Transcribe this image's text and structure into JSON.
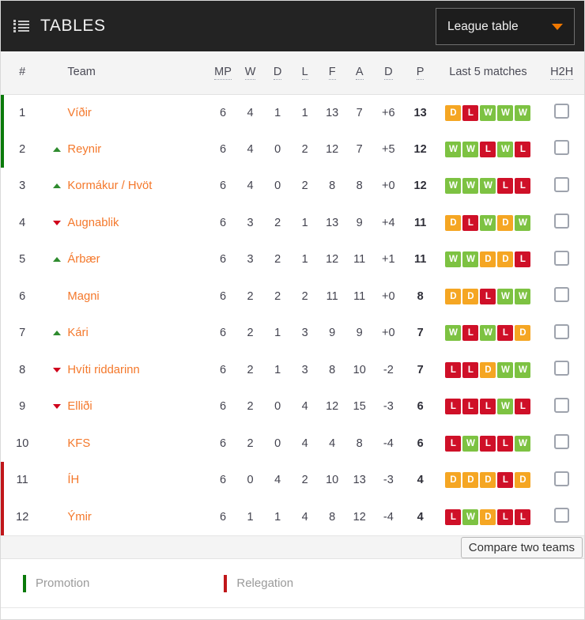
{
  "header": {
    "menu_icon": "list-icon",
    "title": "TABLES",
    "dropdown_label": "League table",
    "dropdown_icon": "chevron-down-icon",
    "accent_color": "#f07800",
    "background": "#232323"
  },
  "table": {
    "columns": {
      "rank": "#",
      "team": "Team",
      "mp": "MP",
      "w": "W",
      "d": "D",
      "l": "L",
      "f": "F",
      "a": "A",
      "gd": "D",
      "p": "P",
      "form": "Last 5 matches",
      "h2h": "H2H"
    },
    "rows": [
      {
        "rank": "1",
        "movement": "none",
        "team": "Víðir",
        "mp": "6",
        "w": "4",
        "d": "1",
        "l": "1",
        "f": "13",
        "a": "7",
        "gd": "+6",
        "p": "13",
        "form": [
          "D",
          "L",
          "W",
          "W",
          "W"
        ],
        "zone": "promotion"
      },
      {
        "rank": "2",
        "movement": "up",
        "team": "Reynir",
        "mp": "6",
        "w": "4",
        "d": "0",
        "l": "2",
        "f": "12",
        "a": "7",
        "gd": "+5",
        "p": "12",
        "form": [
          "W",
          "W",
          "L",
          "W",
          "L"
        ],
        "zone": "promotion"
      },
      {
        "rank": "3",
        "movement": "up",
        "team": "Kormákur / Hvöt",
        "mp": "6",
        "w": "4",
        "d": "0",
        "l": "2",
        "f": "8",
        "a": "8",
        "gd": "+0",
        "p": "12",
        "form": [
          "W",
          "W",
          "W",
          "L",
          "L"
        ],
        "zone": "none"
      },
      {
        "rank": "4",
        "movement": "down",
        "team": "Augnablik",
        "mp": "6",
        "w": "3",
        "d": "2",
        "l": "1",
        "f": "13",
        "a": "9",
        "gd": "+4",
        "p": "11",
        "form": [
          "D",
          "L",
          "W",
          "D",
          "W"
        ],
        "zone": "none"
      },
      {
        "rank": "5",
        "movement": "up",
        "team": "Árbær",
        "mp": "6",
        "w": "3",
        "d": "2",
        "l": "1",
        "f": "12",
        "a": "11",
        "gd": "+1",
        "p": "11",
        "form": [
          "W",
          "W",
          "D",
          "D",
          "L"
        ],
        "zone": "none"
      },
      {
        "rank": "6",
        "movement": "none",
        "team": "Magni",
        "mp": "6",
        "w": "2",
        "d": "2",
        "l": "2",
        "f": "11",
        "a": "11",
        "gd": "+0",
        "p": "8",
        "form": [
          "D",
          "D",
          "L",
          "W",
          "W"
        ],
        "zone": "none"
      },
      {
        "rank": "7",
        "movement": "up",
        "team": "Kári",
        "mp": "6",
        "w": "2",
        "d": "1",
        "l": "3",
        "f": "9",
        "a": "9",
        "gd": "+0",
        "p": "7",
        "form": [
          "W",
          "L",
          "W",
          "L",
          "D"
        ],
        "zone": "none"
      },
      {
        "rank": "8",
        "movement": "down",
        "team": "Hvíti riddarinn",
        "mp": "6",
        "w": "2",
        "d": "1",
        "l": "3",
        "f": "8",
        "a": "10",
        "gd": "-2",
        "p": "7",
        "form": [
          "L",
          "L",
          "D",
          "W",
          "W"
        ],
        "zone": "none"
      },
      {
        "rank": "9",
        "movement": "down",
        "team": "Elliði",
        "mp": "6",
        "w": "2",
        "d": "0",
        "l": "4",
        "f": "12",
        "a": "15",
        "gd": "-3",
        "p": "6",
        "form": [
          "L",
          "L",
          "L",
          "W",
          "L"
        ],
        "zone": "none"
      },
      {
        "rank": "10",
        "movement": "none",
        "team": "KFS",
        "mp": "6",
        "w": "2",
        "d": "0",
        "l": "4",
        "f": "4",
        "a": "8",
        "gd": "-4",
        "p": "6",
        "form": [
          "L",
          "W",
          "L",
          "L",
          "W"
        ],
        "zone": "none"
      },
      {
        "rank": "11",
        "movement": "none",
        "team": "ÍH",
        "mp": "6",
        "w": "0",
        "d": "4",
        "l": "2",
        "f": "10",
        "a": "13",
        "gd": "-3",
        "p": "4",
        "form": [
          "D",
          "D",
          "D",
          "L",
          "D"
        ],
        "zone": "relegation"
      },
      {
        "rank": "12",
        "movement": "none",
        "team": "Ýmir",
        "mp": "6",
        "w": "1",
        "d": "1",
        "l": "4",
        "f": "8",
        "a": "12",
        "gd": "-4",
        "p": "4",
        "form": [
          "L",
          "W",
          "D",
          "L",
          "L"
        ],
        "zone": "relegation"
      }
    ]
  },
  "compare": {
    "button_label": "Compare two teams"
  },
  "legend": {
    "promotion_label": "Promotion",
    "relegation_label": "Relegation",
    "promotion_color": "#0a7a0a",
    "relegation_color": "#c0161a"
  },
  "form_colors": {
    "W": "#7dc242",
    "D": "#f5a623",
    "L": "#cf1028"
  }
}
